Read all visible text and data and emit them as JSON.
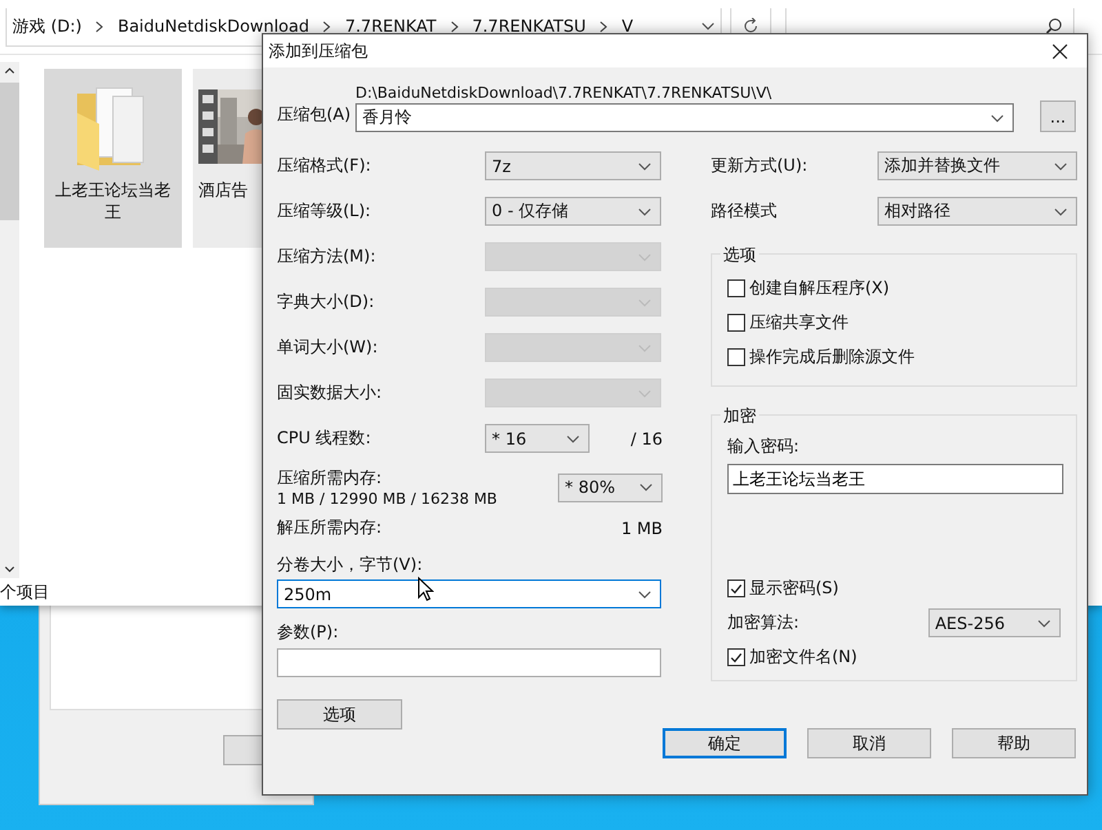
{
  "explorer": {
    "breadcrumb": [
      "游戏 (D:)",
      "BaiduNetdiskDownload",
      "7.7RENKAT",
      "7.7RENKATSU",
      "V"
    ],
    "items": [
      {
        "name": "上老王论坛当老王",
        "kind": "folder",
        "selected": true
      },
      {
        "name": "酒店告",
        "kind": "video",
        "selected": false
      }
    ],
    "status": "个项目"
  },
  "dialog": {
    "title": "添加到压缩包",
    "archive": {
      "label": "压缩包(A)",
      "path": "D:\\BaiduNetdiskDownload\\7.7RENKAT\\7.7RENKATSU\\V\\",
      "name": "香月怜",
      "browse": "..."
    },
    "settings": [
      {
        "kind": "select",
        "label": "压缩格式(F):",
        "value": "7z",
        "disabled": false
      },
      {
        "kind": "select",
        "label": "压缩等级(L):",
        "value": "0 - 仅存储",
        "disabled": false
      },
      {
        "kind": "select",
        "label": "压缩方法(M):",
        "disabled": true
      },
      {
        "kind": "select",
        "label": "字典大小(D):",
        "disabled": true
      },
      {
        "kind": "select",
        "label": "单词大小(W):",
        "disabled": true
      },
      {
        "kind": "select",
        "label": "固实数据大小:",
        "disabled": true
      },
      {
        "kind": "threads",
        "label": "CPU 线程数:",
        "value": "* 16",
        "total": "/ 16",
        "disabled": false
      },
      {
        "kind": "memory",
        "label": "压缩所需内存:",
        "detail": "1 MB / 12990 MB / 16238 MB",
        "value": "* 80%",
        "disabled": false
      },
      {
        "kind": "info",
        "label": "解压所需内存:",
        "value": "1 MB"
      }
    ],
    "volume": {
      "label": "分卷大小，字节(V):",
      "value": "250m"
    },
    "parameters": {
      "label": "参数(P):"
    },
    "options_button": "选项",
    "update": {
      "label": "更新方式(U):",
      "value": "添加并替换文件"
    },
    "path_mode": {
      "label": "路径模式",
      "value": "相对路径"
    },
    "options": {
      "title": "选项",
      "checks": [
        {
          "label": "创建自解压程序(X)",
          "checked": false
        },
        {
          "label": "压缩共享文件",
          "checked": false
        },
        {
          "label": "操作完成后删除源文件",
          "checked": false
        }
      ]
    },
    "encryption": {
      "title": "加密",
      "password_label": "输入密码:",
      "password": "上老王论坛当老王",
      "show_password": {
        "label": "显示密码(S)",
        "checked": true
      },
      "method": {
        "label": "加密算法:",
        "value": "AES-256"
      },
      "encrypt_names": {
        "label": "加密文件名(N)",
        "checked": true
      }
    },
    "buttons": [
      {
        "label": "确定",
        "default": true
      },
      {
        "label": "取消",
        "default": false
      },
      {
        "label": "帮助",
        "default": false
      }
    ]
  }
}
